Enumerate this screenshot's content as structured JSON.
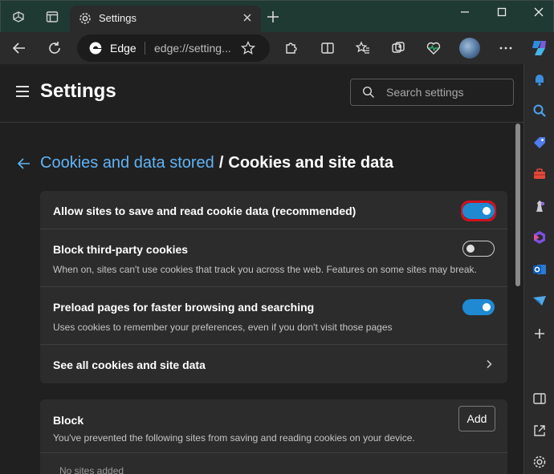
{
  "browser": {
    "tab_title": "Settings",
    "omnibox_brand": "Edge",
    "omnibox_url": "edge://setting..."
  },
  "settings": {
    "page_title": "Settings",
    "search_placeholder": "Search settings",
    "breadcrumb_parent": "Cookies and data stored",
    "breadcrumb_separator": "/",
    "breadcrumb_current": "Cookies and site data"
  },
  "cookie_options": [
    {
      "title": "Allow sites to save and read cookie data (recommended)",
      "description": "",
      "toggle": "on",
      "highlighted": true
    },
    {
      "title": "Block third-party cookies",
      "description": "When on, sites can't use cookies that track you across the web. Features on some sites may break.",
      "toggle": "off",
      "highlighted": false
    },
    {
      "title": "Preload pages for faster browsing and searching",
      "description": "Uses cookies to remember your preferences, even if you don't visit those pages",
      "toggle": "on",
      "highlighted": false
    },
    {
      "title": "See all cookies and site data",
      "description": "",
      "toggle": "none",
      "highlighted": false
    }
  ],
  "block_section": {
    "title": "Block",
    "description": "You've prevented the following sites from saving and reading cookies on your device.",
    "add_label": "Add",
    "empty_text": "No sites added"
  },
  "sidebar_icons": [
    "bell-icon",
    "search-icon",
    "tag-icon",
    "toolbox-icon",
    "chess-icon",
    "office-icon",
    "outlook-icon",
    "send-icon",
    "add-icon",
    "split-screen-icon",
    "open-external-icon",
    "gear-icon"
  ],
  "colors": {
    "accent": "#1f8ad2",
    "link": "#60b4f6",
    "highlight_outline": "#d1121f",
    "titlebar": "#1f3a33"
  }
}
